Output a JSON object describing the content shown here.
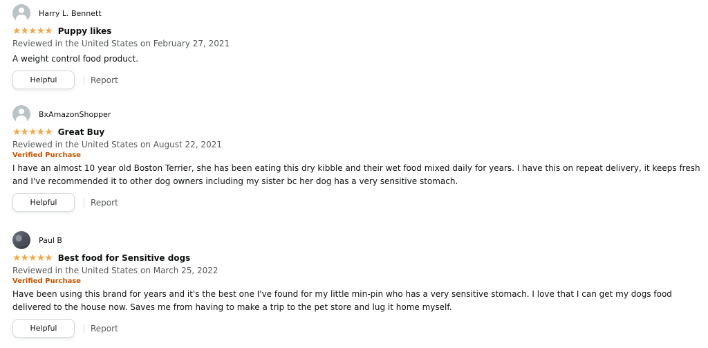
{
  "reviews": [
    {
      "profile_name": "Harry L. Bennett",
      "avatar": "default-avatar-icon",
      "rating": 5,
      "stars": "★★★★★",
      "title": "Puppy likes",
      "date": "Reviewed in the United States on February 27, 2021",
      "verified": "",
      "body": "A weight control food product.",
      "helpful_label": "Helpful",
      "report_label": "Report"
    },
    {
      "profile_name": "BxAmazonShopper",
      "avatar": "default-avatar-icon",
      "rating": 5,
      "stars": "★★★★★",
      "title": "Great Buy",
      "date": "Reviewed in the United States on August 22, 2021",
      "verified": "Verified Purchase",
      "body": "I have an almost 10 year old Boston Terrier, she has been eating this dry kibble and their wet food mixed daily for years. I have this on repeat delivery, it keeps fresh and I've recommended it to other dog owners including my sister bc her dog has a very sensitive stomach.",
      "helpful_label": "Helpful",
      "report_label": "Report"
    },
    {
      "profile_name": "Paul B",
      "avatar": "user-photo-avatar",
      "rating": 5,
      "stars": "★★★★★",
      "title": "Best food for Sensitive dogs",
      "date": "Reviewed in the United States on March 25, 2022",
      "verified": "Verified Purchase",
      "body": "Have been using this brand for years and it's the best one I've found for my little min-pin who has a very sensitive stomach. I love that I can get my dogs food delivered to the house now. Saves me from having to make a trip to the pet store and lug it home myself.",
      "helpful_label": "Helpful",
      "report_label": "Report"
    }
  ],
  "colors": {
    "star": "#f3a847",
    "verified": "#c45500",
    "muted_text": "#565959",
    "button_border": "#d5d9d9"
  }
}
